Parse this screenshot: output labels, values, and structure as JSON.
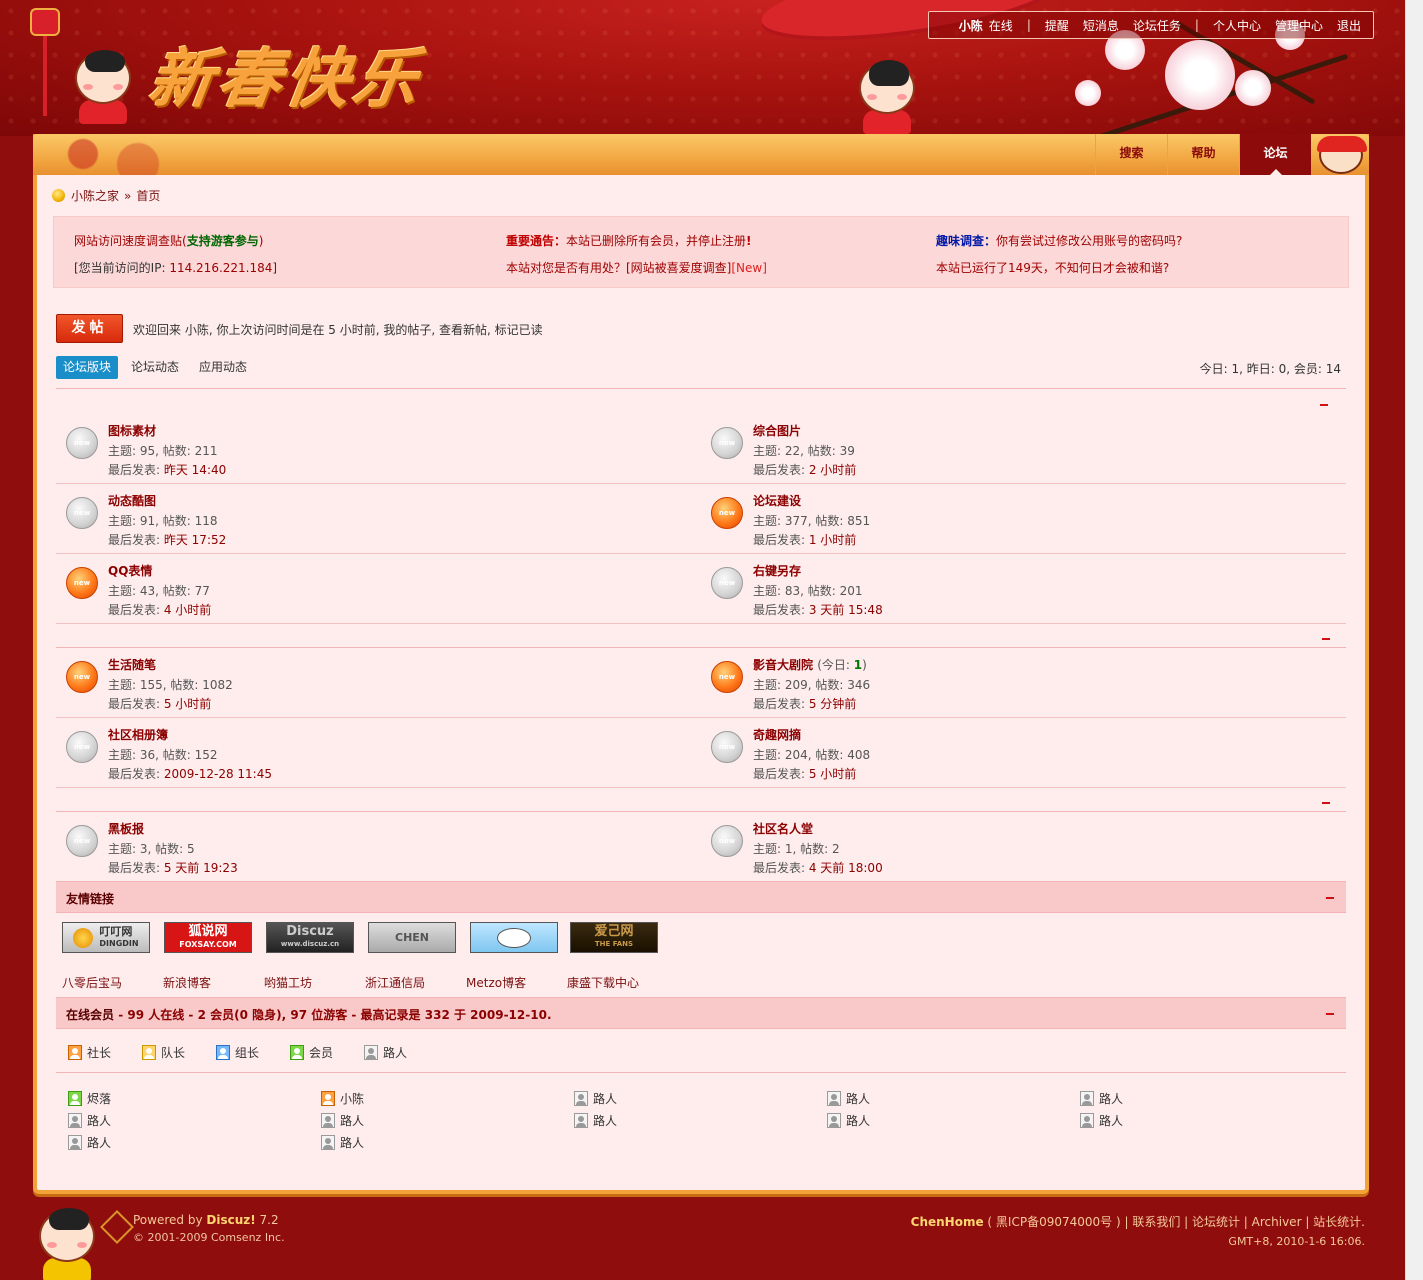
{
  "header": {
    "logo_text": "新春快乐",
    "topnav": {
      "username": "小陈",
      "status": "在线",
      "sep1": "|",
      "remind": "提醒",
      "messages": "短消息",
      "tasks": "论坛任务",
      "sep2": "|",
      "profile": "个人中心",
      "admin": "管理中心",
      "logout": "退出"
    },
    "menu": [
      "搜索",
      "帮助",
      "论坛"
    ]
  },
  "breadcrumb": {
    "home": "小陈之家",
    "sep": "»",
    "current": "首页"
  },
  "announcements": {
    "a1_text": "网站访问速度调查贴(",
    "a1_hl": "支持游客参与",
    "a1_end": ")",
    "ip_prefix": "[您当前访问的IP: ",
    "ip": "114.216.221.184",
    "ip_end": "]",
    "notice_label": "重要通告：",
    "notice_text": "本站已删除所有会员，并停止注册",
    "notice_mark": "!",
    "useful_text": "本站对您是否有用处？[网站被喜爱度调查]",
    "useful_new": "[New]",
    "fun_label": "趣味调查：",
    "fun_text": "你有尝试过修改公用账号的密码吗?",
    "uptime": "本站已运行了149天，不知何日才会被和谐?"
  },
  "post_button": "发帖",
  "welcome": {
    "text": "欢迎回来  小陈, 你上次访问时间是在  5 小时前,",
    "my_posts": "我的帖子,",
    "new_posts": "查看新帖,",
    "mark_read": "标记已读"
  },
  "tabs": [
    "论坛版块",
    "论坛动态",
    "应用动态"
  ],
  "stats": "今日: 1, 昨日: 0, 会员: 14",
  "forums": [
    {
      "name": "图标素材",
      "stat": "主题: 95, 帖数: 211",
      "last_label": "最后发表: ",
      "last": "昨天 14:40",
      "icon": "old",
      "today": ""
    },
    {
      "name": "综合图片",
      "stat": "主题: 22, 帖数: 39",
      "last_label": "最后发表: ",
      "last": "2 小时前",
      "icon": "old",
      "today": ""
    },
    {
      "name": "动态酷图",
      "stat": "主题: 91, 帖数: 118",
      "last_label": "最后发表: ",
      "last": "昨天 17:52",
      "icon": "old",
      "today": ""
    },
    {
      "name": "论坛建设",
      "stat": "主题: 377, 帖数: 851",
      "last_label": "最后发表: ",
      "last": "1 小时前",
      "icon": "new",
      "today": ""
    },
    {
      "name": "QQ表情",
      "stat": "主题: 43, 帖数: 77",
      "last_label": "最后发表: ",
      "last": "4 小时前",
      "icon": "new",
      "today": ""
    },
    {
      "name": "右键另存",
      "stat": "主题: 83, 帖数: 201",
      "last_label": "最后发表: ",
      "last": "3 天前 15:48",
      "icon": "old",
      "today": ""
    },
    {
      "name": "生活随笔",
      "stat": "主题: 155, 帖数: 1082",
      "last_label": "最后发表: ",
      "last": "5 小时前",
      "icon": "new",
      "today": ""
    },
    {
      "name": "影音大剧院",
      "stat": "主题: 209, 帖数: 346",
      "last_label": "最后发表: ",
      "last": "5 分钟前",
      "icon": "new",
      "today": "1"
    },
    {
      "name": "社区相册簿",
      "stat": "主题: 36, 帖数: 152",
      "last_label": "最后发表: ",
      "last": "2009-12-28 11:45",
      "icon": "old",
      "today": ""
    },
    {
      "name": "奇趣网摘",
      "stat": "主题: 204, 帖数: 408",
      "last_label": "最后发表: ",
      "last": "5 小时前",
      "icon": "old",
      "today": ""
    },
    {
      "name": "黑板报",
      "stat": "主题: 3, 帖数: 5",
      "last_label": "最后发表: ",
      "last": "5 天前 19:23",
      "icon": "old",
      "today": ""
    },
    {
      "name": "社区名人堂",
      "stat": "主题: 1, 帖数: 2",
      "last_label": "最后发表: ",
      "last": "4 天前 18:00",
      "icon": "old",
      "today": ""
    }
  ],
  "today_label": "今日: ",
  "icon_text": "new",
  "links": {
    "title": "友情链接",
    "images": [
      "叮叮网",
      "狐说网",
      "Discuz",
      "CHEN",
      "",
      "爱己网"
    ],
    "image_subs": [
      "DINGDIN",
      "FOXSAY.COM",
      "www.discuz.cn",
      "",
      "",
      "THE FANS"
    ],
    "texts": [
      "八零后宝马",
      "新浪博客",
      "哟猫工坊",
      "浙江通信局",
      "Metzo博客",
      "康盛下载中心"
    ]
  },
  "online": {
    "title": "在线会员",
    "count_prefix": " - ",
    "count": "99",
    "count_mid": " 人在线  - ",
    "members": "2",
    "members_text": " 会员(0 隐身), 97 位游客  - 最高记录是  ",
    "record": "332",
    "record_mid": " 于  ",
    "record_date": "2009-12-10",
    "end": ".",
    "roles": [
      {
        "label": "社长",
        "color": "orange"
      },
      {
        "label": "队长",
        "color": "yellow"
      },
      {
        "label": "组长",
        "color": "blue"
      },
      {
        "label": "会员",
        "color": "green"
      },
      {
        "label": "路人",
        "color": "gray"
      }
    ],
    "users": [
      {
        "name": "烬落",
        "color": "green"
      },
      {
        "name": "小陈",
        "color": "orange"
      },
      {
        "name": "路人",
        "color": "gray"
      },
      {
        "name": "路人",
        "color": "gray"
      },
      {
        "name": "路人",
        "color": "gray"
      },
      {
        "name": "路人",
        "color": "gray"
      },
      {
        "name": "路人",
        "color": "gray"
      },
      {
        "name": "路人",
        "color": "gray"
      },
      {
        "name": "路人",
        "color": "gray"
      },
      {
        "name": "路人",
        "color": "gray"
      },
      {
        "name": "路人",
        "color": "gray"
      },
      {
        "name": "路人",
        "color": "gray"
      }
    ]
  },
  "footer": {
    "powered": "Powered by ",
    "product": "Discuz!",
    "version": " 7.2",
    "copyright": "© 2001-2009 Comsenz Inc.",
    "brand": "ChenHome",
    "icp": " ( 黑ICP备09074000号 ) | 联系我们  | 论坛统计 | Archiver | 站长统计.",
    "gmt": "GMT+8, 2010-1-6 16:06."
  }
}
